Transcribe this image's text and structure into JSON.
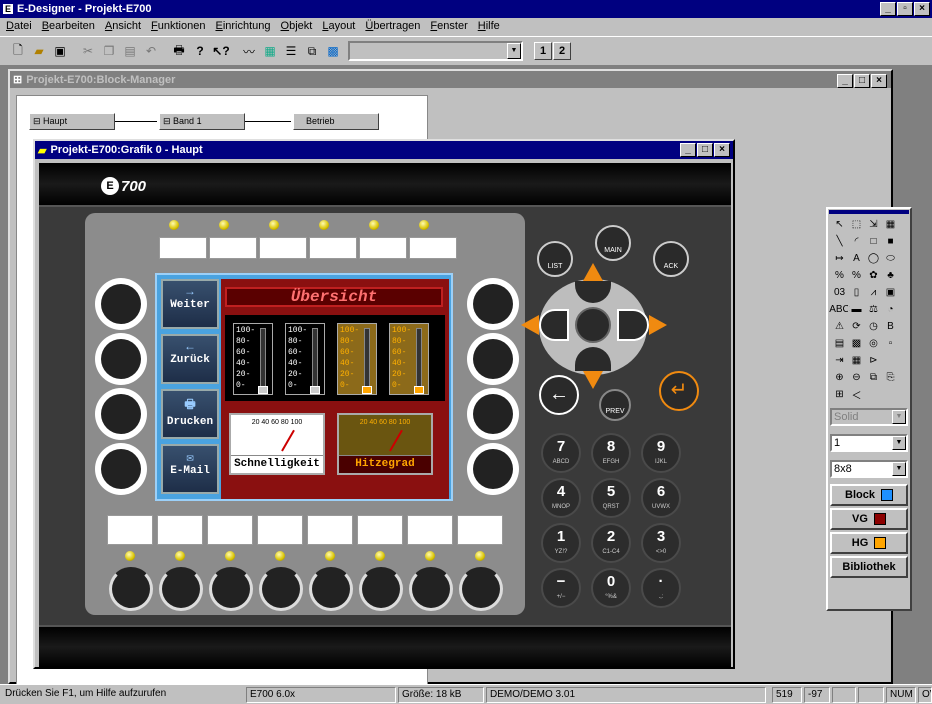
{
  "app": {
    "title": "E-Designer - Projekt-E700"
  },
  "menu": [
    "Datei",
    "Bearbeiten",
    "Ansicht",
    "Funktionen",
    "Einrichtung",
    "Objekt",
    "Layout",
    "Übertragen",
    "Fenster",
    "Hilfe"
  ],
  "toolbar": {
    "page1": "1",
    "page2": "2"
  },
  "block_manager": {
    "title": "Projekt-E700:Block-Manager",
    "blocks": [
      "Haupt",
      "Band 1",
      "Betrieb"
    ]
  },
  "grafik": {
    "title": "Projekt-E700:Grafik 0 - Haupt",
    "logo": "700"
  },
  "hmi": {
    "header": "Übersicht",
    "nav": [
      {
        "icon": "→",
        "label": "Weiter"
      },
      {
        "icon": "←",
        "label": "Zurück"
      },
      {
        "icon": "🖶",
        "label": "Drucken"
      },
      {
        "icon": "✉",
        "label": "E-Mail"
      }
    ],
    "bar_ticks": [
      "100-",
      "80-",
      "60-",
      "40-",
      "20-",
      "0-"
    ],
    "bars": [
      {
        "fill": 0.0,
        "style": "dark"
      },
      {
        "fill": 0.0,
        "style": "dark"
      },
      {
        "fill": 0.0,
        "style": "orange"
      },
      {
        "fill": 0.0,
        "style": "orange"
      }
    ],
    "gauges": [
      {
        "label": "Schnelligkeit",
        "scale": "20 40 60 80 100"
      },
      {
        "label": "Hitzegrad",
        "scale": "20 40 60 80 100"
      }
    ],
    "top_keys": [
      "LIST",
      "MAIN",
      "ACK"
    ],
    "prev_key": "PREV",
    "keypad": [
      {
        "n": "7",
        "s": "ABCD"
      },
      {
        "n": "8",
        "s": "EFGH"
      },
      {
        "n": "9",
        "s": "IJKL"
      },
      {
        "n": "4",
        "s": "MNOP"
      },
      {
        "n": "5",
        "s": "QRST"
      },
      {
        "n": "6",
        "s": "UVWX"
      },
      {
        "n": "1",
        "s": "YZ!?"
      },
      {
        "n": "2",
        "s": "C1-C4"
      },
      {
        "n": "3",
        "s": "<>0"
      },
      {
        "n": "−",
        "s": "+/−"
      },
      {
        "n": "0",
        "s": "°%&"
      },
      {
        "n": "·",
        "s": ".,:"
      }
    ]
  },
  "palette": {
    "line_style": "Solid",
    "line_width": "1",
    "font_size": "8x8",
    "block_label": "Block",
    "vg_label": "VG",
    "hg_label": "HG",
    "bib_label": "Bibliothek",
    "colors": {
      "block": "#1e90ff",
      "vg": "#8b0000",
      "hg": "#ffa500"
    }
  },
  "status": {
    "help": "Drücken Sie F1, um Hilfe aufzurufen",
    "version": "E700 6.0x",
    "size": "Größe: 18 kB",
    "demo": "DEMO/DEMO 3.01",
    "x": "519",
    "y": "-97",
    "num": "NUM",
    "ov": "OV"
  }
}
